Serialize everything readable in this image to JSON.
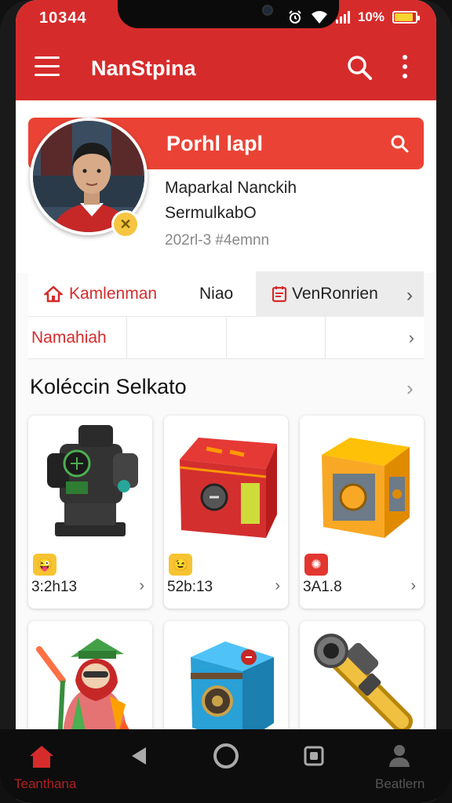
{
  "status": {
    "time": "10344",
    "battery": "10%"
  },
  "appbar": {
    "title": "NanStpina"
  },
  "profile": {
    "banner_title": "Porhl lapl",
    "name": "Maparkal Nanckih",
    "subtitle": "SermulkabO",
    "date": "202rl-3 #4emnn"
  },
  "tabs": [
    {
      "label": "Kamlenman",
      "icon": "home-icon"
    },
    {
      "label": "Niao"
    },
    {
      "label": "VenRonrien",
      "icon": "calendar-icon"
    }
  ],
  "subtabs": [
    {
      "label": "Namahiah"
    }
  ],
  "section": {
    "title": "Koléccin Selkato"
  },
  "items": [
    {
      "value": "3:2h13",
      "badge": "😜",
      "badge_color": "#f6c431",
      "icon": "machine-icon"
    },
    {
      "value": "52b:13",
      "badge": "😉",
      "badge_color": "#f6c431",
      "icon": "red-chest-icon"
    },
    {
      "value": "3A1.8",
      "badge": "✺",
      "badge_color": "#e2362f",
      "icon": "gold-chest-icon"
    },
    {
      "icon": "warrior-icon"
    },
    {
      "icon": "blue-chest-icon"
    },
    {
      "icon": "scope-icon"
    }
  ],
  "bottomnav": {
    "home_label": "Teanthana",
    "user_label": "Beatlern"
  },
  "colors": {
    "primary": "#d62b2b",
    "banner": "#ea4335"
  }
}
